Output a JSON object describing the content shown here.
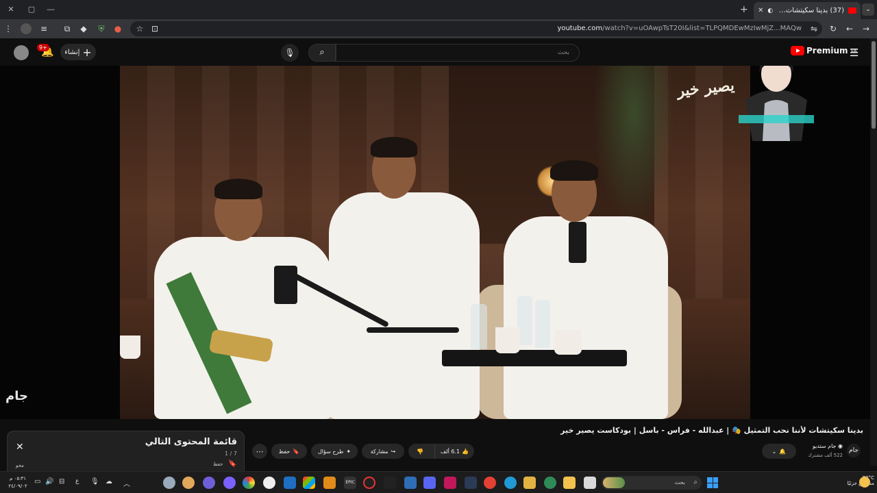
{
  "browser": {
    "tab_title": "(37) بدينا سكيتشات لأننا نحب...",
    "url_host": "youtube.com",
    "url_path": "/watch?v=uOAwpTsT20I&list=TLPQMDEwMzIwMjZ...MAQw",
    "new_tab": "+",
    "tab_close": "✕"
  },
  "youtube": {
    "logo_text": "Premium",
    "region": "SA",
    "search_placeholder": "بحث",
    "create_label": "إنشاء",
    "notification_count": "9+",
    "video_title": "بدينا سكيتشات لأننا نحب التمثيل 🎭 | عبدالله - فراس - باسل | بودكاست يصير خير",
    "channel_name": "جام ستديو",
    "subscribers": "522 ألف مشترك",
    "likes": "6.1 ألف",
    "share_label": "مشاركة",
    "ask_label": "طرح سؤال",
    "save_label": "حفظ",
    "show_logo": "يصير خير",
    "watermark": "جام"
  },
  "queue": {
    "title": "قائمة المحتوى التالي",
    "count": "1 / 7",
    "save_label": "حفظ",
    "sort_label": "محو"
  },
  "taskbar": {
    "search_label": "بحث",
    "weather_temp": "28°C",
    "weather_text": "مشمس جزئيًا",
    "time": "٠٥:٣١ م",
    "date": "٢٤/٠٩/٠٢",
    "lang": "ع"
  },
  "colors": {
    "accent": "#ff0000",
    "background": "#0f0f0f"
  }
}
